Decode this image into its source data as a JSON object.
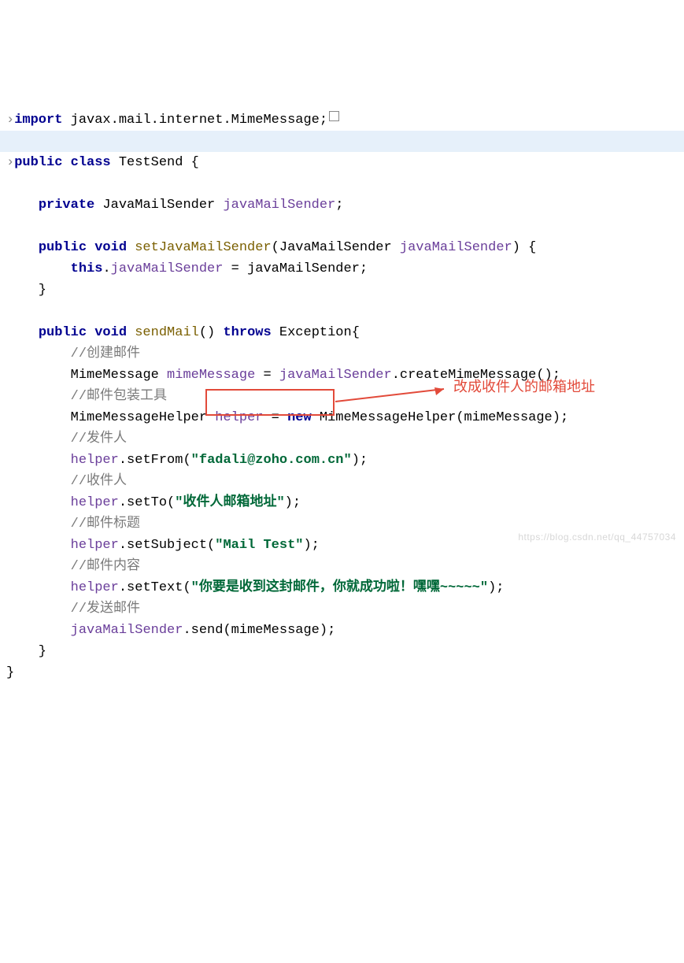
{
  "code": {
    "l1_import": "import",
    "l1_pkg": " javax.mail.internet.MimeMessage;",
    "l2_blank": "",
    "l3_public": "public class",
    "l3_name": " TestSend {",
    "l4_blank": "",
    "l5_private": "private",
    "l5_rest": " JavaMailSender ",
    "l5_field": "javaMailSender",
    "l5_semi": ";",
    "l6_blank": "",
    "l7_pub": "public void",
    "l7_meth": " setJavaMailSender",
    "l7_args": "(JavaMailSender ",
    "l7_param": "javaMailSender",
    "l7_end": ") {",
    "l8_this": "this",
    "l8_dot": ".",
    "l8_field": "javaMailSender",
    "l8_eq": " = javaMailSender;",
    "l9_close": "    }",
    "l10_blank": "",
    "l11_pub": "public void",
    "l11_meth": " sendMail",
    "l11_paren": "() ",
    "l11_throws": "throws",
    "l11_ex": " Exception{",
    "l12_comment": "//创建邮件",
    "l13a": "MimeMessage ",
    "l13b": "mimeMessage",
    "l13c": " = ",
    "l13d": "javaMailSender",
    "l13e": ".createMimeMessage();",
    "l14_comment": "//邮件包装工具",
    "l15a": "MimeMessageHelper ",
    "l15b": "helper",
    "l15c": " = ",
    "l15_new": "new",
    "l15d": " MimeMessageHelper(mimeMessage);",
    "l16_comment": "//发件人",
    "l17a": "helper",
    "l17b": ".setFrom(",
    "l17_str": "\"fadali@zoho.com.cn\"",
    "l17c": ");",
    "l18_comment": "//收件人",
    "l19a": "helper",
    "l19b": ".setTo(",
    "l19_str": "\"收件人邮箱地址\"",
    "l19c": ");",
    "l20_comment": "//邮件标题",
    "l21a": "helper",
    "l21b": ".setSubject(",
    "l21_str": "\"Mail Test\"",
    "l21c": ");",
    "l22_comment": "//邮件内容",
    "l23a": "helper",
    "l23b": ".setText(",
    "l23_str": "\"你要是收到这封邮件，你就成功啦！嘿嘿~~~~~\"",
    "l23c": ");",
    "l24_comment": "//发送邮件",
    "l25a": "javaMailSender",
    "l25b": ".send(mimeMessage);",
    "l26_close": "    }",
    "l27_close": "}"
  },
  "annotation": {
    "text": "改成收件人的邮箱地址"
  },
  "watermark": "https://blog.csdn.net/qq_44757034"
}
